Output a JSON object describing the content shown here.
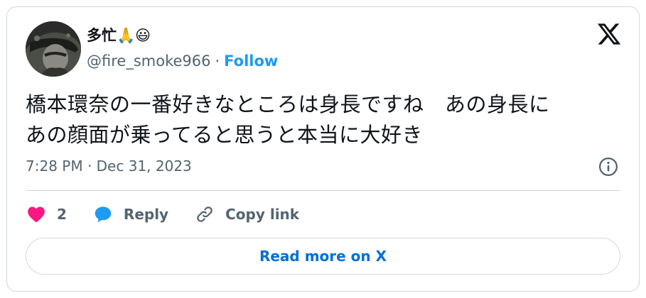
{
  "author": {
    "display_name": "多忙🙏😃",
    "handle": "@fire_smoke966",
    "separator": "·",
    "follow_label": "Follow"
  },
  "tweet": {
    "text_line1": "橋本環奈の一番好きなところは身長ですね　あの身長に",
    "text_line2": "あの顔面が乗ってると思うと本当に大好き",
    "timestamp": "7:28 PM · Dec 31, 2023"
  },
  "actions": {
    "like_count": "2",
    "reply_label": "Reply",
    "copy_link_label": "Copy link"
  },
  "footer": {
    "read_more_label": "Read more on X"
  },
  "icons": {
    "brand": "x-logo",
    "info": "info-icon",
    "like": "heart-icon",
    "reply": "speech-bubble-icon",
    "copy": "link-icon"
  },
  "colors": {
    "accent": "#1d9bf0",
    "like": "#f91880",
    "link_text": "#006fd6",
    "muted": "#536471",
    "border": "#cfd9de"
  }
}
